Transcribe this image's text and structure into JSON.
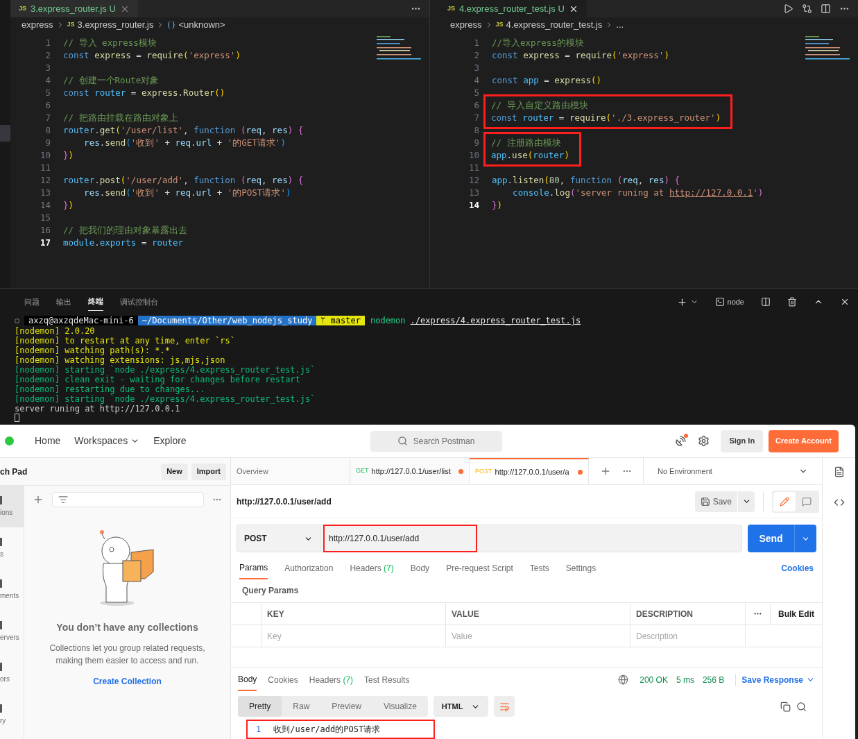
{
  "editors": [
    {
      "tab": {
        "file_icon": "JS",
        "title": "3.express_router.js",
        "status": "U",
        "selected": false
      },
      "breadcrumb": [
        {
          "text": "express"
        },
        {
          "icon": "JS",
          "text": "3.express_router.js"
        },
        {
          "text": "<unknown>"
        }
      ],
      "blocks": [
        {
          "highlighted": false,
          "lines": [
            {
              "n": "1",
              "current": false,
              "tokens": [
                {
                  "kind": "cm",
                  "text": "// 导入 express模块"
                }
              ]
            },
            {
              "n": "2",
              "current": false,
              "tokens": [
                {
                  "kind": "kw",
                  "text": "const "
                },
                {
                  "kind": "fn",
                  "text": "express"
                },
                {
                  "kind": "op",
                  "text": " = "
                },
                {
                  "kind": "fn",
                  "text": "require"
                },
                {
                  "kind": "b1",
                  "text": "("
                },
                {
                  "kind": "str",
                  "text": "'express'"
                },
                {
                  "kind": "b1",
                  "text": ")"
                }
              ]
            },
            {
              "n": "3",
              "current": false
            },
            {
              "n": "4",
              "current": false,
              "tokens": [
                {
                  "kind": "cm",
                  "text": "// 创建一个Route对象"
                }
              ]
            },
            {
              "n": "5",
              "current": false,
              "tokens": [
                {
                  "kind": "kw",
                  "text": "const "
                },
                {
                  "kind": "const",
                  "text": "router"
                },
                {
                  "kind": "op",
                  "text": " = "
                },
                {
                  "kind": "fn",
                  "text": "express"
                },
                {
                  "kind": "op",
                  "text": "."
                },
                {
                  "kind": "fn",
                  "text": "Router"
                },
                {
                  "kind": "b1",
                  "text": "()"
                }
              ]
            },
            {
              "n": "6",
              "current": false
            },
            {
              "n": "7",
              "current": false,
              "tokens": [
                {
                  "kind": "cm",
                  "text": "// 把路由挂载在路由对象上"
                }
              ]
            },
            {
              "n": "8",
              "current": false,
              "tokens": [
                {
                  "kind": "const",
                  "text": "router"
                },
                {
                  "kind": "op",
                  "text": "."
                },
                {
                  "kind": "fn",
                  "text": "get"
                },
                {
                  "kind": "b1",
                  "text": "("
                },
                {
                  "kind": "str",
                  "text": "'/user/list'"
                },
                {
                  "kind": "op",
                  "text": ", "
                },
                {
                  "kind": "kw",
                  "text": "function "
                },
                {
                  "kind": "b2",
                  "text": "("
                },
                {
                  "kind": "var",
                  "text": "req"
                },
                {
                  "kind": "op",
                  "text": ", "
                },
                {
                  "kind": "var",
                  "text": "res"
                },
                {
                  "kind": "b2",
                  "text": ")"
                },
                {
                  "kind": "b2",
                  "text": " {"
                }
              ]
            },
            {
              "n": "9",
              "current": false,
              "tokens": [
                {
                  "kind": "var",
                  "text": "    res"
                },
                {
                  "kind": "op",
                  "text": "."
                },
                {
                  "kind": "fn",
                  "text": "send"
                },
                {
                  "kind": "b3",
                  "text": "("
                },
                {
                  "kind": "str",
                  "text": "'收到'"
                },
                {
                  "kind": "op",
                  "text": " + "
                },
                {
                  "kind": "var",
                  "text": "req"
                },
                {
                  "kind": "op",
                  "text": "."
                },
                {
                  "kind": "var",
                  "text": "url"
                },
                {
                  "kind": "op",
                  "text": " + "
                },
                {
                  "kind": "str",
                  "text": "'的GET请求'"
                },
                {
                  "kind": "b3",
                  "text": ")"
                }
              ]
            },
            {
              "n": "10",
              "current": false,
              "tokens": [
                {
                  "kind": "b2",
                  "text": "}"
                },
                {
                  "kind": "b1",
                  "text": ")"
                }
              ]
            },
            {
              "n": "11",
              "current": false
            },
            {
              "n": "12",
              "current": false,
              "tokens": [
                {
                  "kind": "const",
                  "text": "router"
                },
                {
                  "kind": "op",
                  "text": "."
                },
                {
                  "kind": "fn",
                  "text": "post"
                },
                {
                  "kind": "b1",
                  "text": "("
                },
                {
                  "kind": "str",
                  "text": "'/user/add'"
                },
                {
                  "kind": "op",
                  "text": ", "
                },
                {
                  "kind": "kw",
                  "text": "function "
                },
                {
                  "kind": "b2",
                  "text": "("
                },
                {
                  "kind": "var",
                  "text": "req"
                },
                {
                  "kind": "op",
                  "text": ", "
                },
                {
                  "kind": "var",
                  "text": "res"
                },
                {
                  "kind": "b2",
                  "text": ")"
                },
                {
                  "kind": "b2",
                  "text": " {"
                }
              ]
            },
            {
              "n": "13",
              "current": false,
              "tokens": [
                {
                  "kind": "var",
                  "text": "    res"
                },
                {
                  "kind": "op",
                  "text": "."
                },
                {
                  "kind": "fn",
                  "text": "send"
                },
                {
                  "kind": "b3",
                  "text": "("
                },
                {
                  "kind": "str",
                  "text": "'收到'"
                },
                {
                  "kind": "op",
                  "text": " + "
                },
                {
                  "kind": "var",
                  "text": "req"
                },
                {
                  "kind": "op",
                  "text": "."
                },
                {
                  "kind": "var",
                  "text": "url"
                },
                {
                  "kind": "op",
                  "text": " + "
                },
                {
                  "kind": "str",
                  "text": "'的POST请求'"
                },
                {
                  "kind": "b3",
                  "text": ")"
                }
              ]
            },
            {
              "n": "14",
              "current": false,
              "tokens": [
                {
                  "kind": "b2",
                  "text": "}"
                },
                {
                  "kind": "b1",
                  "text": ")"
                }
              ]
            },
            {
              "n": "15",
              "current": false
            },
            {
              "n": "16",
              "current": false,
              "tokens": [
                {
                  "kind": "cm",
                  "text": "// 把我们的理由对象暴露出去"
                }
              ]
            },
            {
              "n": "17",
              "current": true,
              "tokens": [
                {
                  "kind": "const",
                  "text": "module"
                },
                {
                  "kind": "op",
                  "text": "."
                },
                {
                  "kind": "const",
                  "text": "exports"
                },
                {
                  "kind": "op",
                  "text": " = "
                },
                {
                  "kind": "const",
                  "text": "router"
                }
              ]
            }
          ]
        }
      ]
    },
    {
      "tab": {
        "file_icon": "JS",
        "title": "4.express_router_test.js",
        "status": "U",
        "selected": true
      },
      "breadcrumb": [
        {
          "text": "express"
        },
        {
          "icon": "JS",
          "text": "4.express_router_test.js"
        },
        {
          "text": "..."
        }
      ],
      "blocks": [
        {
          "highlighted": false,
          "lines": [
            {
              "n": "1",
              "current": false,
              "tokens": [
                {
                  "kind": "cm",
                  "text": "//导入express的模块"
                }
              ]
            },
            {
              "n": "2",
              "current": false,
              "tokens": [
                {
                  "kind": "kw",
                  "text": "const "
                },
                {
                  "kind": "fn",
                  "text": "express"
                },
                {
                  "kind": "op",
                  "text": " = "
                },
                {
                  "kind": "fn",
                  "text": "require"
                },
                {
                  "kind": "b1",
                  "text": "("
                },
                {
                  "kind": "str",
                  "text": "'express'"
                },
                {
                  "kind": "b1",
                  "text": ")"
                }
              ]
            },
            {
              "n": "3",
              "current": false
            },
            {
              "n": "4",
              "current": false,
              "tokens": [
                {
                  "kind": "kw",
                  "text": "const "
                },
                {
                  "kind": "const",
                  "text": "app"
                },
                {
                  "kind": "op",
                  "text": " = "
                },
                {
                  "kind": "fn",
                  "text": "express"
                },
                {
                  "kind": "b1",
                  "text": "()"
                }
              ]
            },
            {
              "n": "5",
              "current": false
            }
          ]
        },
        {
          "highlighted": true,
          "lines": [
            {
              "n": "6",
              "current": false,
              "tokens": [
                {
                  "kind": "cm",
                  "text": "// 导入自定义路由模块"
                }
              ]
            },
            {
              "n": "7",
              "current": false,
              "tokens": [
                {
                  "kind": "kw",
                  "text": "const "
                },
                {
                  "kind": "const",
                  "text": "router"
                },
                {
                  "kind": "op",
                  "text": " = "
                },
                {
                  "kind": "fn",
                  "text": "require"
                },
                {
                  "kind": "b1",
                  "text": "("
                },
                {
                  "kind": "str",
                  "text": "'./3.express_router'"
                },
                {
                  "kind": "b1",
                  "text": ")"
                }
              ]
            }
          ]
        },
        {
          "highlighted": false,
          "lines": [
            {
              "n": "8",
              "current": false
            }
          ]
        },
        {
          "highlighted": true,
          "lines": [
            {
              "n": "9",
              "current": false,
              "tokens": [
                {
                  "kind": "cm",
                  "text": "// 注册路由模块"
                }
              ]
            },
            {
              "n": "10",
              "current": false,
              "tokens": [
                {
                  "kind": "const",
                  "text": "app"
                },
                {
                  "kind": "op",
                  "text": "."
                },
                {
                  "kind": "fn",
                  "text": "use"
                },
                {
                  "kind": "b1",
                  "text": "("
                },
                {
                  "kind": "const",
                  "text": "router"
                },
                {
                  "kind": "b1",
                  "text": ")"
                }
              ]
            }
          ]
        },
        {
          "highlighted": false,
          "lines": [
            {
              "n": "11",
              "current": false
            },
            {
              "n": "12",
              "current": false,
              "tokens": [
                {
                  "kind": "const",
                  "text": "app"
                },
                {
                  "kind": "op",
                  "text": "."
                },
                {
                  "kind": "fn",
                  "text": "listen"
                },
                {
                  "kind": "b1",
                  "text": "("
                },
                {
                  "kind": "num",
                  "text": "80"
                },
                {
                  "kind": "op",
                  "text": ", "
                },
                {
                  "kind": "kw",
                  "text": "function "
                },
                {
                  "kind": "b2",
                  "text": "("
                },
                {
                  "kind": "var",
                  "text": "req"
                },
                {
                  "kind": "op",
                  "text": ", "
                },
                {
                  "kind": "var",
                  "text": "res"
                },
                {
                  "kind": "b2",
                  "text": ")"
                },
                {
                  "kind": "b2",
                  "text": " {"
                }
              ]
            },
            {
              "n": "13",
              "current": false,
              "tokens": [
                {
                  "kind": "const",
                  "text": "    console"
                },
                {
                  "kind": "op",
                  "text": "."
                },
                {
                  "kind": "fn",
                  "text": "log"
                },
                {
                  "kind": "b2",
                  "text": "("
                },
                {
                  "kind": "str",
                  "text": "'server runing at "
                },
                {
                  "kind": "link",
                  "text": "http://127.0.0.1"
                },
                {
                  "kind": "str",
                  "text": "'"
                },
                {
                  "kind": "b2",
                  "text": ")"
                }
              ]
            },
            {
              "n": "14",
              "current": true,
              "tokens": [
                {
                  "kind": "b2",
                  "text": "}"
                },
                {
                  "kind": "b1",
                  "text": ")"
                }
              ]
            }
          ]
        }
      ]
    }
  ],
  "panel": {
    "tabs": [
      {
        "label": "问题",
        "selected": false
      },
      {
        "label": "输出",
        "selected": false
      },
      {
        "label": "终端",
        "selected": true
      },
      {
        "label": "调试控制台",
        "selected": false
      }
    ],
    "terminal_name": "node",
    "prompt": {
      "user": "axzq@axzqdeMac-mini-6",
      "path": "~/Documents/Other/web_nodejs_study",
      "branch_icon": "ᛘ",
      "branch": "master",
      "command": "nodemon",
      "arg": "./express/4.express_router_test.js"
    },
    "lines": [
      {
        "kind": "yellow",
        "text": "[nodemon] 2.0.20"
      },
      {
        "kind": "yellow",
        "text": "[nodemon] to restart at any time, enter `rs`"
      },
      {
        "kind": "yellow",
        "text": "[nodemon] watching path(s): *.*"
      },
      {
        "kind": "yellow",
        "text": "[nodemon] watching extensions: js,mjs,json"
      },
      {
        "kind": "green",
        "text": "[nodemon] starting `node ./express/4.express_router_test.js`"
      },
      {
        "kind": "green",
        "text": "[nodemon] clean exit - waiting for changes before restart"
      },
      {
        "kind": "green",
        "text": "[nodemon] restarting due to changes..."
      },
      {
        "kind": "green",
        "text": "[nodemon] starting `node ./express/4.express_router_test.js`"
      },
      {
        "kind": "plain",
        "text": "server runing at http://127.0.0.1"
      }
    ]
  },
  "postman": {
    "nav": [
      "Home",
      "Workspaces",
      "Explore"
    ],
    "search_placeholder": "Search Postman",
    "sign_in": "Sign In",
    "create_account": "Create Account",
    "sidebar": {
      "title": "ch Pad",
      "new": "New",
      "import": "Import",
      "rail": [
        {
          "label": "ions",
          "selected": true
        },
        {
          "label": "s",
          "selected": false
        },
        {
          "label": "ments",
          "selected": false
        },
        {
          "label": "ervers",
          "selected": false
        },
        {
          "label": "ors",
          "selected": false
        },
        {
          "label": "ry",
          "selected": false
        }
      ],
      "empty_title": "You don’t have any collections",
      "empty_text": "Collections let you group related requests, making them easier to access and run.",
      "create_link": "Create Collection"
    },
    "tabs": [
      {
        "kind": "overview",
        "label": "Overview",
        "selected": false
      },
      {
        "kind": "request",
        "method": "GET",
        "label": "http://127.0.0.1/user/list",
        "unsaved": true,
        "selected": false
      },
      {
        "kind": "request",
        "method": "POST",
        "label": "http://127.0.0.1/user/a",
        "unsaved": true,
        "selected": true
      }
    ],
    "environment": "No Environment",
    "request": {
      "title": "http://127.0.0.1/user/add",
      "save": "Save",
      "method": "POST",
      "url": "http://127.0.0.1/user/add",
      "url_highlighted": true,
      "send": "Send",
      "tabs": [
        {
          "label": "Params",
          "selected": true
        },
        {
          "label": "Authorization",
          "selected": false
        },
        {
          "label": "Headers",
          "count": "(7)",
          "selected": false
        },
        {
          "label": "Body",
          "selected": false
        },
        {
          "label": "Pre-request Script",
          "selected": false
        },
        {
          "label": "Tests",
          "selected": false
        },
        {
          "label": "Settings",
          "selected": false
        }
      ],
      "cookies": "Cookies",
      "query_title": "Query Params",
      "columns": [
        "KEY",
        "VALUE",
        "DESCRIPTION"
      ],
      "bulk_edit": "Bulk Edit",
      "placeholders": [
        "Key",
        "Value",
        "Description"
      ]
    },
    "response": {
      "tabs": [
        {
          "label": "Body",
          "selected": true
        },
        {
          "label": "Cookies",
          "selected": false
        },
        {
          "label": "Headers",
          "count": "(7)",
          "selected": false
        },
        {
          "label": "Test Results",
          "selected": false
        }
      ],
      "status": "200 OK",
      "time": "5 ms",
      "size": "256 B",
      "save_response": "Save Response",
      "views": [
        {
          "label": "Pretty",
          "selected": true
        },
        {
          "label": "Raw",
          "selected": false
        },
        {
          "label": "Preview",
          "selected": false
        },
        {
          "label": "Visualize",
          "selected": false
        }
      ],
      "format": "HTML",
      "body_lines": [
        {
          "n": "1",
          "text": "收到/user/add的POST请求",
          "highlighted": true
        }
      ]
    }
  }
}
